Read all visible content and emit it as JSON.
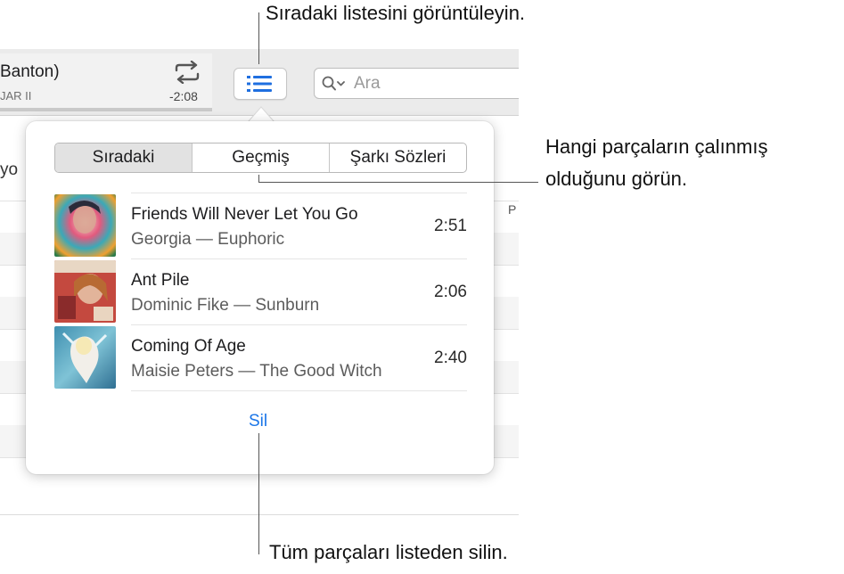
{
  "toolbar": {
    "now_playing_title": "Banton)",
    "now_playing_subtitle": "JAR II",
    "now_playing_remaining": "-2:08",
    "repeat_icon": "repeat-icon",
    "queue_icon": "list-icon",
    "search_placeholder": "Ara"
  },
  "background": {
    "column_left_fragment": "yo",
    "column_right_fragment": "P"
  },
  "popover": {
    "tabs": [
      {
        "label": "Sıradaki",
        "selected": true
      },
      {
        "label": "Geçmiş",
        "selected": false
      },
      {
        "label": "Şarkı Sözleri",
        "selected": false
      }
    ],
    "tracks": [
      {
        "title": "Friends Will Never Let You Go",
        "subtitle": "Georgia — Euphoric",
        "duration": "2:51"
      },
      {
        "title": "Ant Pile",
        "subtitle": "Dominic Fike — Sunburn",
        "duration": "2:06"
      },
      {
        "title": "Coming Of Age",
        "subtitle": "Maisie Peters — The Good Witch",
        "duration": "2:40"
      }
    ],
    "clear_label": "Sil"
  },
  "callouts": {
    "queue": "Sıradaki listesini görüntüleyin.",
    "history_line1": "Hangi parçaların çalınmış",
    "history_line2": "olduğunu görün.",
    "clear": "Tüm parçaları listeden silin."
  },
  "colors": {
    "accent": "#1b76e8",
    "queue_icon": "#1f6fe0",
    "toolbar_bg": "#ebebeb",
    "segment_selected_bg": "#e2e2e2"
  }
}
